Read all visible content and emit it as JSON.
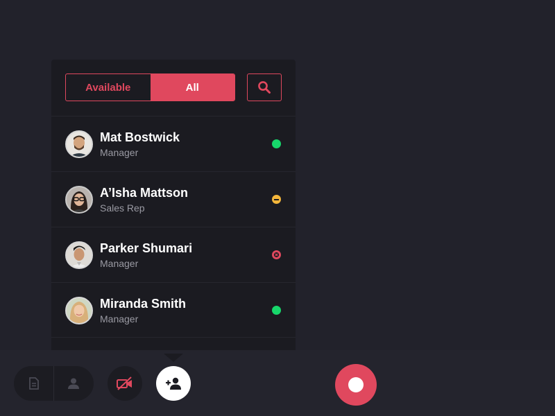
{
  "filter": {
    "available_label": "Available",
    "all_label": "All",
    "selected": "All",
    "search_icon": "search-icon"
  },
  "contacts": [
    {
      "name": "Mat Bostwick",
      "role": "Manager",
      "status": "available",
      "status_color": "#17d76b"
    },
    {
      "name": "A’Isha Mattson",
      "role": "Sales Rep",
      "status": "busy",
      "status_color": "#f3b63b"
    },
    {
      "name": "Parker Shumari",
      "role": "Manager",
      "status": "do-not-disturb",
      "status_color": "#e0485e"
    },
    {
      "name": "Miranda Smith",
      "role": "Manager",
      "status": "available",
      "status_color": "#17d76b"
    }
  ],
  "toolbar": {
    "notes_icon": "document-icon",
    "profile_icon": "person-icon",
    "camera_icon": "video-off-icon",
    "add_icon": "person-add-icon",
    "record_icon": "record-icon"
  },
  "colors": {
    "accent": "#e0485e",
    "background": "#22222b",
    "panel": "#1b1b21",
    "available": "#17d76b",
    "busy": "#f3b63b"
  }
}
